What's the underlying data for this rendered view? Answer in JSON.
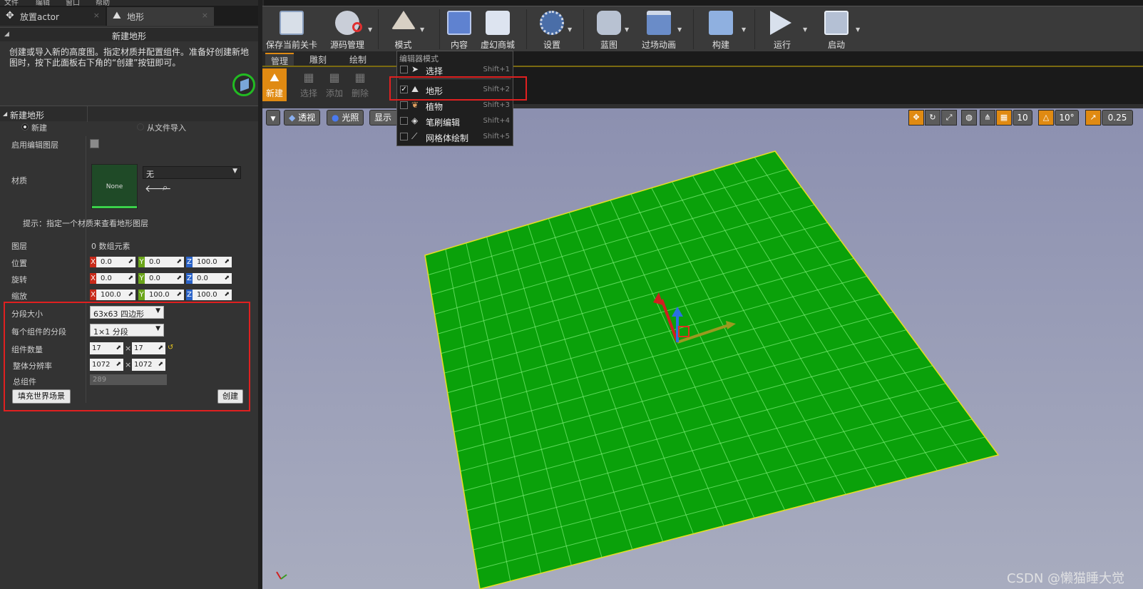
{
  "menubar": {
    "items": [
      "文件",
      "编辑",
      "窗口",
      "帮助"
    ]
  },
  "tabs": [
    {
      "label": "放置actor",
      "close": "×"
    },
    {
      "label": "地形",
      "close": "×"
    }
  ],
  "landscape_header": "新建地形",
  "description": "创建或导入新的高度图。指定材质并配置组件。准备好创建新地图时，按下此面板右下角的“创建”按钮即可。",
  "section_title": "新建地形",
  "radio": {
    "new": "新建",
    "import": "从文件导入"
  },
  "rows": {
    "enable_edit_layers": "启用编辑图层",
    "material": "材质",
    "material_thumb": "None",
    "material_combo": "无",
    "hint": "提示：指定一个材质来查看地形图层",
    "layers": "图层",
    "layers_value": "0 数组元素",
    "location": "位置",
    "rotation": "旋转",
    "scale": "缩放",
    "section_size": "分段大小",
    "section_size_value": "63x63 四边形",
    "sections_per_component": "每个组件的分段",
    "sections_per_component_value": "1×1 分段",
    "component_count": "组件数量",
    "component_x": "17",
    "component_y": "17",
    "overall_resolution": "整体分辨率",
    "res_x": "1072",
    "res_y": "1072",
    "total_components": "总组件",
    "total_components_value": "289",
    "fill_world": "填充世界场景",
    "create": "创建",
    "times": "×"
  },
  "vectors": {
    "location": [
      "0.0",
      "0.0",
      "100.0"
    ],
    "rotation": [
      "0.0",
      "0.0",
      "0.0"
    ],
    "scale": [
      "100.0",
      "100.0",
      "100.0"
    ],
    "axis": [
      "X",
      "Y",
      "Z"
    ]
  },
  "toolbar": {
    "items": [
      "保存当前关卡",
      "源码管理",
      "模式",
      "内容",
      "虚幻商城",
      "设置",
      "蓝图",
      "过场动画",
      "构建",
      "运行",
      "启动"
    ]
  },
  "mode_tabs": [
    "管理",
    "雕刻",
    "绘制"
  ],
  "sub_tools": [
    "新建",
    "选择",
    "添加",
    "删除"
  ],
  "viewport": {
    "perspective": "透视",
    "lit": "光照",
    "show": "显示",
    "grid_snap": "10",
    "rot_snap": "10°",
    "scale_snap": "0.25"
  },
  "dropdown": {
    "title": "编辑器模式",
    "items": [
      {
        "label": "选择",
        "shortcut": "Shift+1",
        "checked": false
      },
      {
        "label": "地形",
        "shortcut": "Shift+2",
        "checked": true
      },
      {
        "label": "植物",
        "shortcut": "Shift+3",
        "checked": false
      },
      {
        "label": "笔刷编辑",
        "shortcut": "Shift+4",
        "checked": false
      },
      {
        "label": "网格体绘制",
        "shortcut": "Shift+5",
        "checked": false
      }
    ],
    "check_glyph": "✓"
  },
  "watermark": "CSDN @懒猫睡大觉",
  "colors": {
    "landscape": "#0aa10a",
    "grid_line": "#7ff07a",
    "highlight": "#e02020",
    "accent": "#e08a12"
  }
}
